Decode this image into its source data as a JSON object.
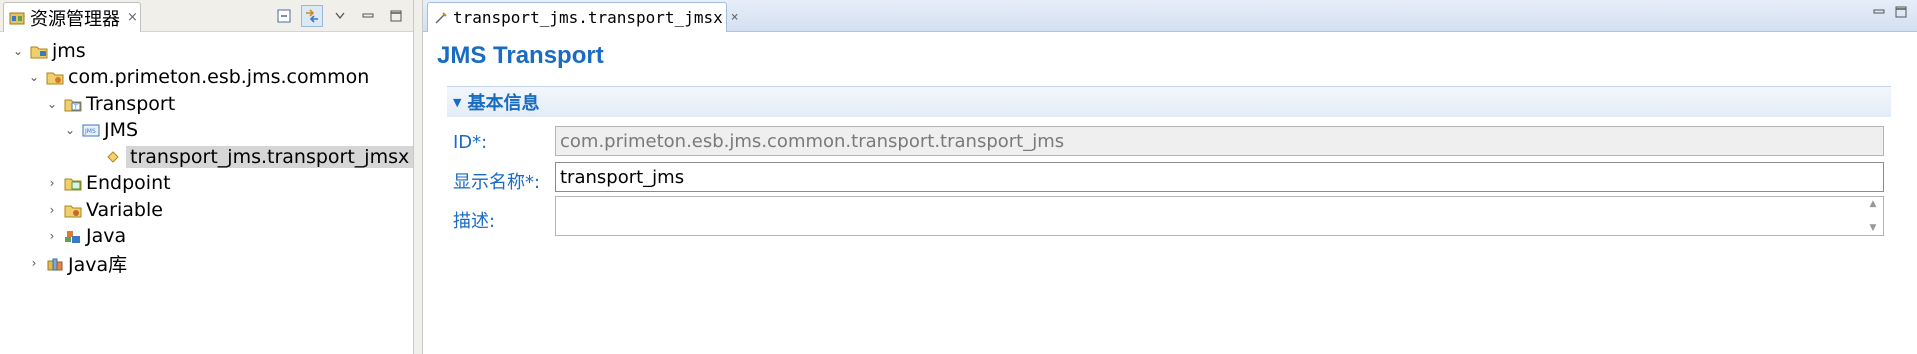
{
  "explorer": {
    "tab_title": "资源管理器",
    "tab_close": "×",
    "toolbar": {
      "collapse_icon": "collapse-all-icon",
      "link_icon": "link-with-editor-icon",
      "menu_icon": "view-menu-icon",
      "minimize_icon": "minimize-icon",
      "maximize_icon": "maximize-icon"
    },
    "tree": [
      {
        "label": "jms",
        "icon": "project-folder-icon",
        "expanded": true,
        "depth": 0
      },
      {
        "label": "com.primeton.esb.jms.common",
        "icon": "package-icon",
        "expanded": true,
        "depth": 1
      },
      {
        "label": "Transport",
        "icon": "transport-folder-icon",
        "expanded": true,
        "depth": 2
      },
      {
        "label": "JMS",
        "icon": "jms-icon",
        "expanded": true,
        "depth": 3
      },
      {
        "label": "transport_jms.transport_jmsx",
        "icon": "transport-file-icon",
        "expanded": null,
        "depth": 4,
        "selected": true
      },
      {
        "label": "Endpoint",
        "icon": "endpoint-folder-icon",
        "expanded": false,
        "depth": 2
      },
      {
        "label": "Variable",
        "icon": "variable-folder-icon",
        "expanded": false,
        "depth": 2
      },
      {
        "label": "Java",
        "icon": "java-folder-icon",
        "expanded": false,
        "depth": 2
      },
      {
        "label": "Java库",
        "icon": "java-library-icon",
        "expanded": false,
        "depth": 1
      }
    ]
  },
  "editor": {
    "tab_title": "transport_jms.transport_jmsx",
    "tab_close": "×",
    "form_title": "JMS Transport",
    "section_title": "基本信息",
    "fields": {
      "id_label": "ID*:",
      "id_value": "com.primeton.esb.jms.common.transport.transport_jms",
      "display_name_label": "显示名称*:",
      "display_name_value": "transport_jms",
      "description_label": "描述:",
      "description_value": ""
    }
  },
  "colors": {
    "accent": "#1a6bc2",
    "selection": "#d6d6d6",
    "editor_tab_bar": "#d3e0f1"
  }
}
